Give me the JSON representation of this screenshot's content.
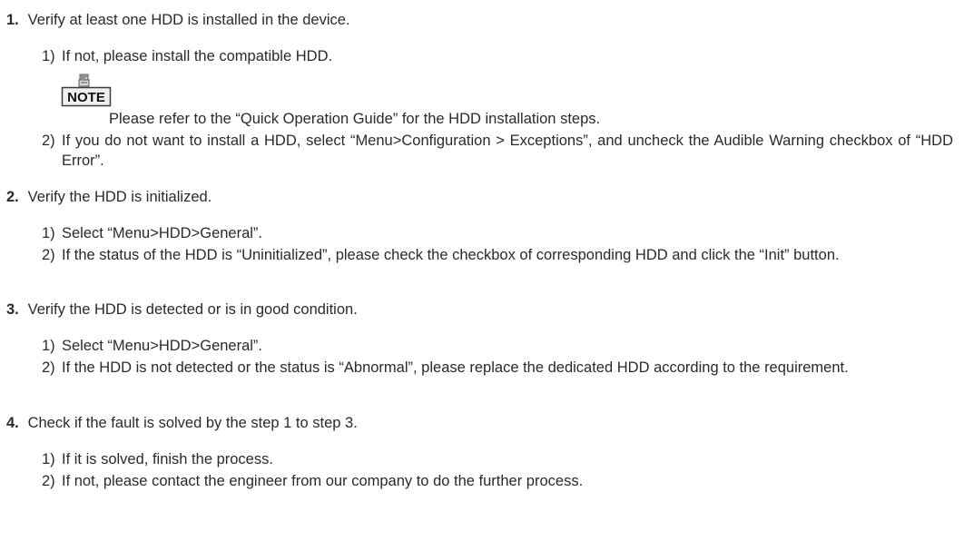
{
  "steps": [
    {
      "num": "1.",
      "text": "Verify at least one HDD is installed in the device.",
      "items": [
        {
          "mark": "1)",
          "text": "If not, please install the compatible HDD."
        },
        {
          "mark": "2)",
          "text": "If you do not want to install a HDD, select “Menu>Configuration > Exceptions”, and uncheck the Audible Warning checkbox of “HDD Error”."
        }
      ],
      "note": {
        "label": "NOTE",
        "text": "Please refer to the “Quick Operation Guide” for the HDD installation steps."
      }
    },
    {
      "num": "2.",
      "text": "Verify the HDD is initialized.",
      "items": [
        {
          "mark": "1)",
          "text": "Select “Menu>HDD>General”."
        },
        {
          "mark": "2)",
          "text": "If the status of the HDD is “Uninitialized”, please check the checkbox of corresponding HDD and click the “Init” button."
        }
      ]
    },
    {
      "num": "3.",
      "text": "Verify the HDD is detected or is in good condition.",
      "items": [
        {
          "mark": "1)",
          "text": "Select “Menu>HDD>General”."
        },
        {
          "mark": "2)",
          "text": "If the HDD is not detected or the status is “Abnormal”, please replace the dedicated HDD according to the requirement."
        }
      ]
    },
    {
      "num": "4.",
      "text": "Check if the fault is solved by the step 1 to step 3.",
      "items": [
        {
          "mark": "1)",
          "text": "If it is solved, finish the process."
        },
        {
          "mark": "2)",
          "text": "If not, please contact the engineer from our company to do the further process."
        }
      ]
    }
  ]
}
